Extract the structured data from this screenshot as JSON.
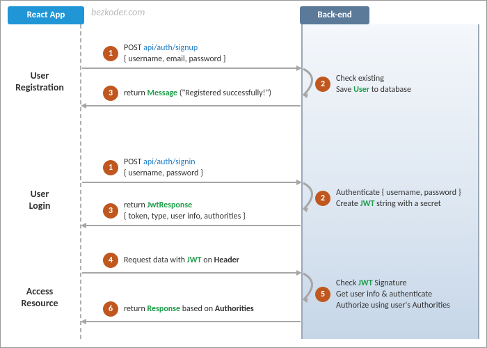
{
  "watermark": "bezkoder.com",
  "headers": {
    "left": "React App",
    "right": "Back-end"
  },
  "sections": {
    "reg": {
      "l1": "User",
      "l2": "Registration"
    },
    "login": {
      "l1": "User",
      "l2": "Login"
    },
    "access": {
      "l1": "Access",
      "l2": "Resource"
    }
  },
  "reg": {
    "s1": {
      "num": "1",
      "line1_pre": "POST ",
      "api": "api/auth/signup",
      "line2": "{ username, email, password }"
    },
    "s2": {
      "num": "2",
      "line1": "Check existing",
      "line2_pre": "Save ",
      "kw": "User",
      "line2_post": " to database"
    },
    "s3": {
      "num": "3",
      "pre": "return ",
      "kw": "Message",
      "post": " (\"Registered successfully!\")"
    }
  },
  "login": {
    "s1": {
      "num": "1",
      "line1_pre": "POST ",
      "api": "api/auth/signin",
      "line2": "{ username, password }"
    },
    "s2": {
      "num": "2",
      "line1": "Authenticate { username, password }",
      "line2_pre": "Create ",
      "kw": "JWT",
      "line2_post": " string with a secret"
    },
    "s3": {
      "num": "3",
      "line1_pre": "return ",
      "kw": "JwtResponse",
      "line2": "{ token, type, user info, authorities }"
    }
  },
  "access": {
    "s4": {
      "num": "4",
      "pre": "Request  data with ",
      "kw": "JWT",
      "post": " on ",
      "kw2": "Header"
    },
    "s5": {
      "num": "5",
      "line1_pre": "Check ",
      "kw": "JWT",
      "line1_post": " Signature",
      "line2": "Get user info & authenticate",
      "line3": "Authorize using user's Authorities"
    },
    "s6": {
      "num": "6",
      "pre": "return ",
      "kw": "Response",
      "mid": " based on ",
      "kw2": "Authorities"
    }
  }
}
